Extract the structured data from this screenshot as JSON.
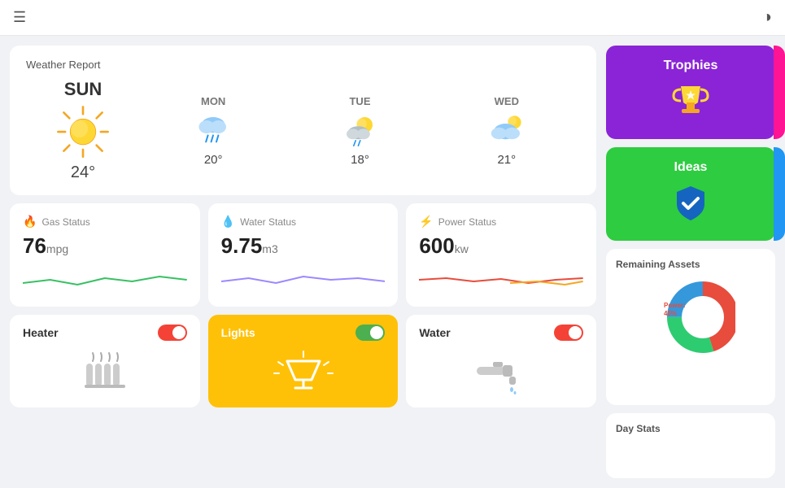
{
  "header": {
    "menu_icon": "☰",
    "theme_icon": "◑"
  },
  "weather": {
    "title": "Weather Report",
    "today": {
      "day": "SUN",
      "temp": "24°"
    },
    "forecast": [
      {
        "day": "MON",
        "temp": "20°",
        "type": "rain"
      },
      {
        "day": "TUE",
        "temp": "18°",
        "type": "partly-cloudy"
      },
      {
        "day": "WED",
        "temp": "21°",
        "type": "cloudy-sun"
      }
    ]
  },
  "status_cards": [
    {
      "id": "gas",
      "label": "Gas Status",
      "value": "76",
      "unit": "mpg",
      "color": "#4caf50",
      "icon": "🔥"
    },
    {
      "id": "water",
      "label": "Water Status",
      "value": "9.75",
      "unit": "m3",
      "color": "#9c88ff",
      "icon": "💧"
    },
    {
      "id": "power",
      "label": "Power Status",
      "value": "600",
      "unit": "kw",
      "color": "#e74c3c",
      "icon": "⚡"
    }
  ],
  "devices": [
    {
      "id": "heater",
      "name": "Heater",
      "state": "off",
      "active": false
    },
    {
      "id": "lights",
      "name": "Lights",
      "state": "on",
      "active": true
    },
    {
      "id": "water",
      "name": "Water",
      "state": "off",
      "active": false
    }
  ],
  "sidebar": {
    "trophies_label": "Trophies",
    "ideas_label": "Ideas",
    "remaining_assets_label": "Remaining Assets",
    "day_stats_label": "Day Stats",
    "donut_label": "Power:\n45%"
  }
}
